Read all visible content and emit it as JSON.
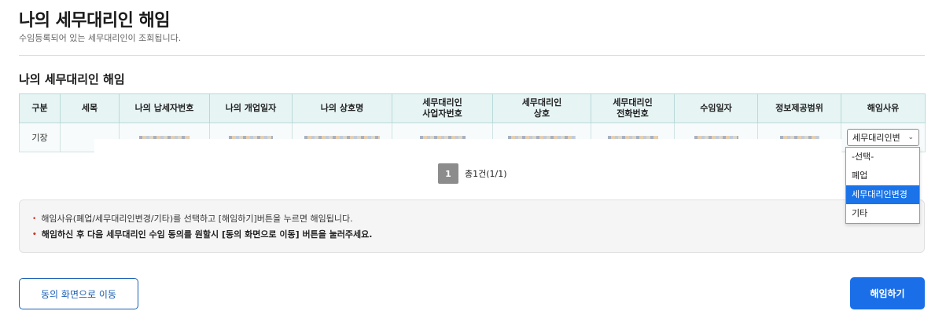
{
  "page": {
    "title": "나의 세무대리인 해임",
    "subtitle": "수임등록되어 있는 세무대리인이 조회됩니다."
  },
  "section": {
    "title": "나의 세무대리인 해임"
  },
  "table": {
    "headers": {
      "h0": "구분",
      "h1": "세목",
      "h2": "나의 납세자번호",
      "h3": "나의 개업일자",
      "h4": "나의 상호명",
      "h5a": "세무대리인",
      "h5b": "사업자번호",
      "h6a": "세무대리인",
      "h6b": "상호",
      "h7a": "세무대리인",
      "h7b": "전화번호",
      "h8": "수임일자",
      "h9": "정보제공범위",
      "h10": "해임사유"
    },
    "row": {
      "category": "기장",
      "select_value": "세무대리인변"
    }
  },
  "dropdown": {
    "options": [
      "-선택-",
      "폐업",
      "세무대리인변경",
      "기타"
    ],
    "selected_index": 2
  },
  "pagination": {
    "current": "1",
    "total": "총1건(1/1)"
  },
  "notice": {
    "line1": "해임사유(폐업/세무대리인변경/기타)를 선택하고 [해임하기]버튼을 누르면 해임됩니다.",
    "line2": "해임하신 후 다음 세무대리인 수임 동의를 원할시 [동의 화면으로 이동] 버튼을 눌러주세요."
  },
  "buttons": {
    "consent_label": "동의 화면으로 이동",
    "dismiss_label": "해임하기"
  },
  "colors": {
    "primary": "#1a6fe8",
    "header_bg": "#e6f4f4",
    "selected_option": "#1a73e8"
  }
}
